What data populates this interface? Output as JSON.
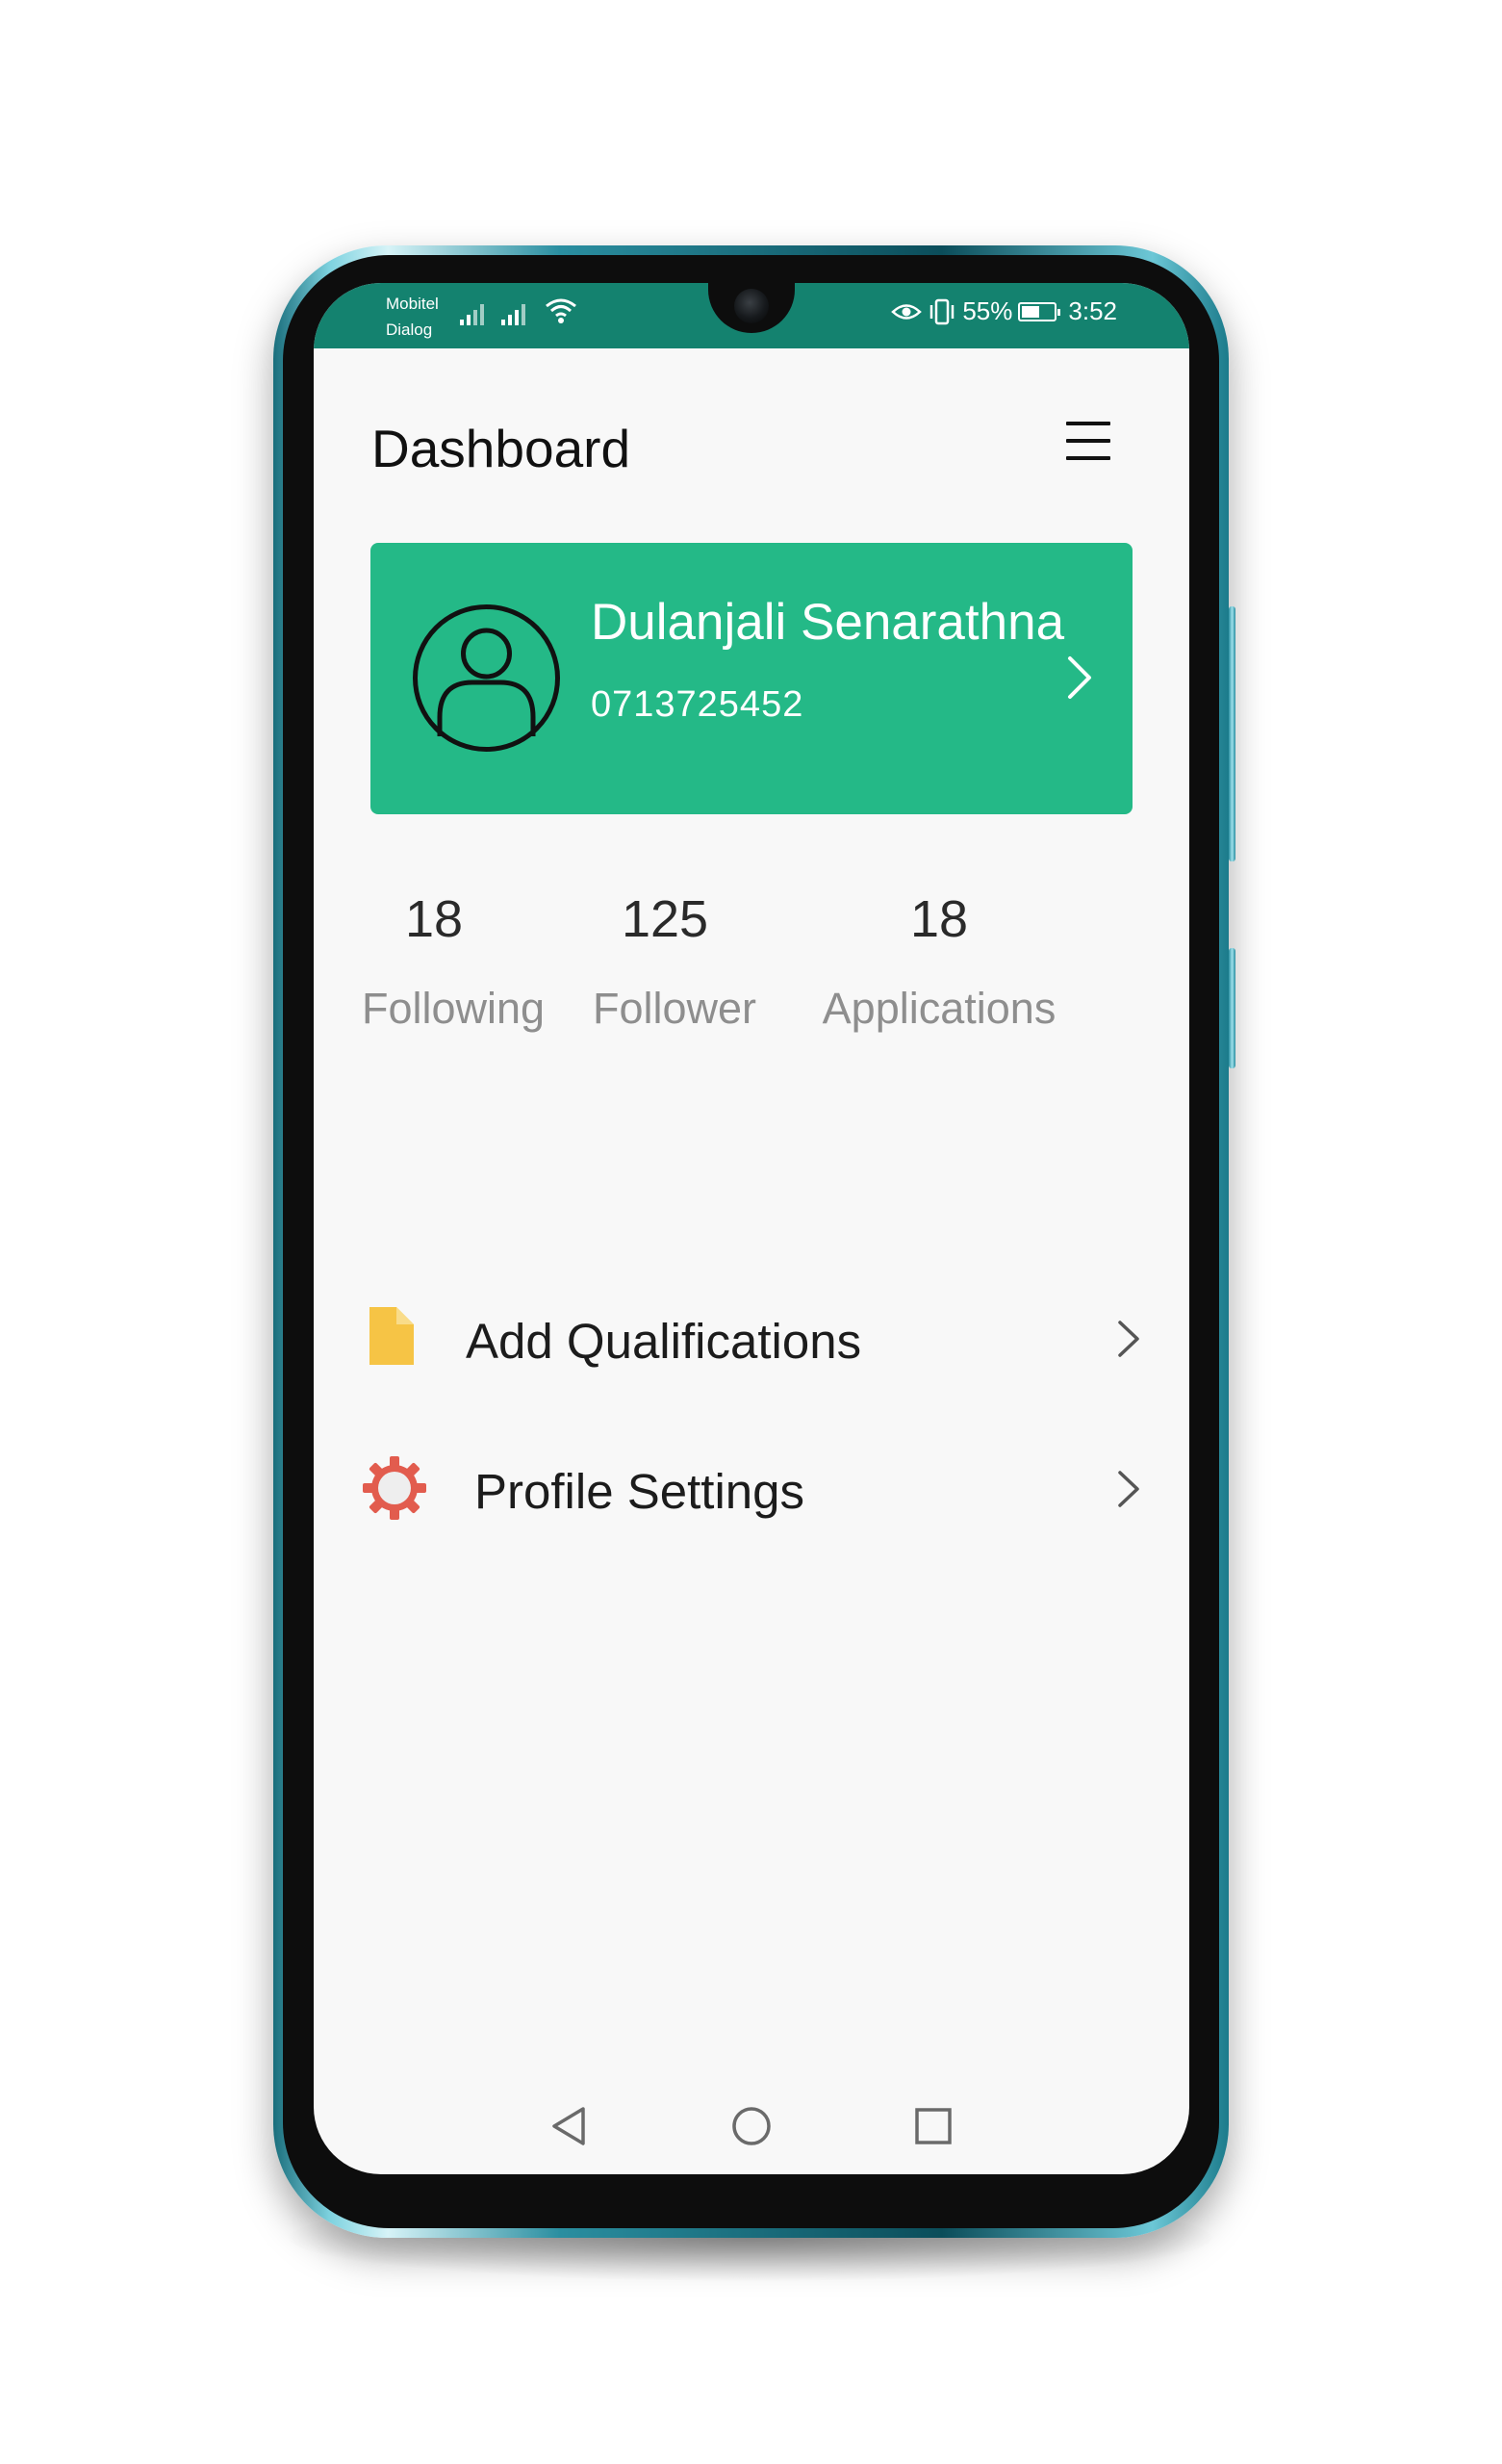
{
  "status_bar": {
    "carrier_1": "Mobitel",
    "carrier_2": "Dialog",
    "battery_percent": "55%",
    "time": "3:52",
    "icons": [
      "signal-icon",
      "wifi-icon",
      "eye-comfort-icon",
      "vibrate-icon",
      "battery-icon"
    ],
    "battery_level": 0.55
  },
  "header": {
    "title": "Dashboard",
    "menu_icon": "hamburger-menu-icon"
  },
  "profile": {
    "name": "Dulanjali Senarathna",
    "phone": "0713725452",
    "avatar_icon": "user-avatar-icon",
    "card_color": "#24b987"
  },
  "stats": [
    {
      "value": "18",
      "label": "Following"
    },
    {
      "value": "125",
      "label": "Follower"
    },
    {
      "value": "18",
      "label": "Applications"
    }
  ],
  "menu": [
    {
      "label": "Add Qualifications",
      "icon": "document-icon"
    },
    {
      "label": "Profile Settings",
      "icon": "gear-icon"
    }
  ],
  "nav": {
    "icons": [
      "back-icon",
      "home-icon",
      "recent-apps-icon"
    ]
  },
  "colors": {
    "status_bar": "#14826f",
    "accent": "#24b987",
    "document_icon": "#f6c445",
    "gear_icon": "#e25c4e"
  }
}
